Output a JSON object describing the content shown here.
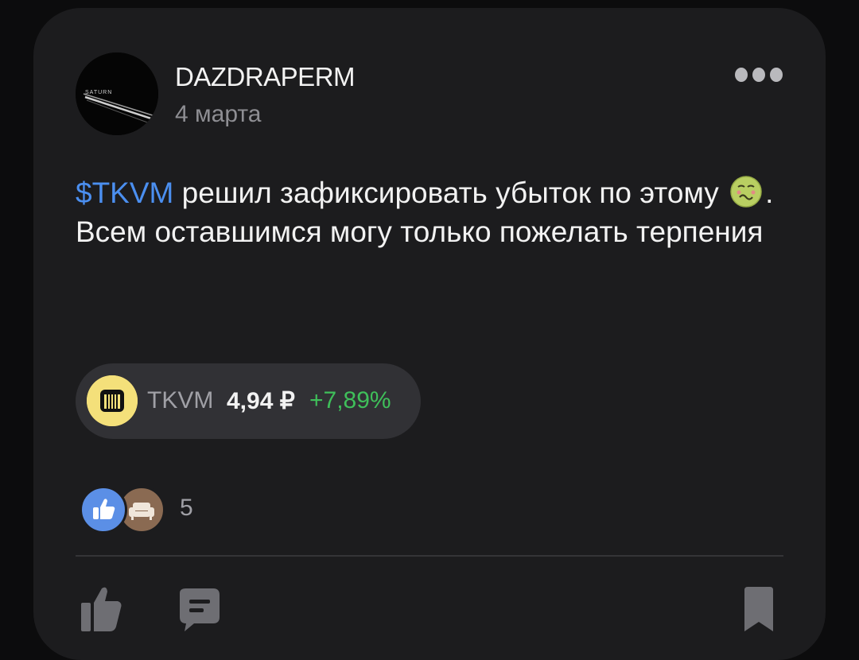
{
  "post": {
    "author": "DAZDRAPERM",
    "date": "4 марта",
    "avatar_text": "SATURN",
    "ticker_link": "$TKVM",
    "text_part1": " решил зафиксировать убыток по этому ",
    "emoji": "nauseated-face",
    "text_part2": ".",
    "text_line2": "Всем оставшимся могу только пожелать терпения"
  },
  "instrument": {
    "ticker": "TKVM",
    "price": "4,94 ₽",
    "change": "+7,89%",
    "change_color": "#3fbf5a",
    "logo_color": "#f4e07a"
  },
  "reactions": {
    "items": [
      "thumbs-up-icon",
      "sofa-icon"
    ],
    "count": "5"
  },
  "actions": [
    "like-icon",
    "comment-icon",
    "bookmark-icon"
  ],
  "colors": {
    "background": "#0c0c0d",
    "card": "#1c1c1e",
    "link": "#4b8ff0",
    "text": "#f2f2f2",
    "muted": "#8e8e93"
  }
}
